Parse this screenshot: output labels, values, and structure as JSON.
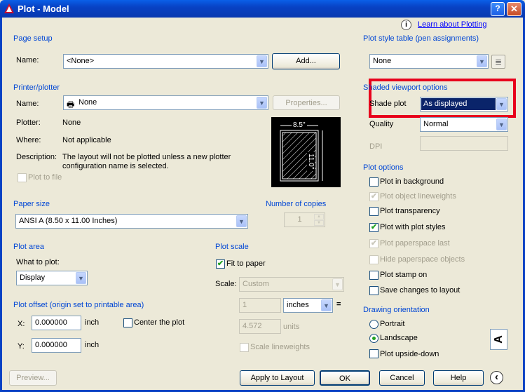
{
  "window": {
    "title": "Plot - Model",
    "help_btn": "?",
    "close_btn": "✕"
  },
  "help_link": {
    "info_icon": "i",
    "label": "Learn about Plotting"
  },
  "page_setup": {
    "group": "Page setup",
    "name_label": "Name:",
    "name_value": "<None>",
    "add_button": "Add..."
  },
  "printer": {
    "group": "Printer/plotter",
    "name_label": "Name:",
    "name_value": "None",
    "properties_button": "Properties...",
    "plotter_label": "Plotter:",
    "plotter_value": "None",
    "where_label": "Where:",
    "where_value": "Not applicable",
    "description_label": "Description:",
    "description_line1": "The layout will not be plotted unless a new plotter",
    "description_line2": "configuration name is selected.",
    "plot_to_file": "Plot to file",
    "preview_width": "8.5''",
    "preview_height": "11.0''"
  },
  "paper_size": {
    "group": "Paper size",
    "value": "ANSI A (8.50 x 11.00 Inches)"
  },
  "copies": {
    "group": "Number of copies",
    "value": "1"
  },
  "plot_area": {
    "group": "Plot area",
    "what_label": "What to plot:",
    "what_value": "Display"
  },
  "plot_offset": {
    "group": "Plot offset (origin set to printable area)",
    "x_label": "X:",
    "x_value": "0.000000",
    "x_unit": "inch",
    "y_label": "Y:",
    "y_value": "0.000000",
    "y_unit": "inch",
    "center": "Center the plot"
  },
  "plot_scale": {
    "group": "Plot scale",
    "fit": "Fit to paper",
    "scale_label": "Scale:",
    "scale_value": "Custom",
    "num_value": "1",
    "unit_value": "inches",
    "equals": "=",
    "den_value": "4.572",
    "den_unit": "units",
    "scale_lineweights": "Scale lineweights"
  },
  "style_table": {
    "group": "Plot style table (pen assignments)",
    "value": "None"
  },
  "shaded": {
    "group": "Shaded viewport options",
    "shade_label": "Shade plot",
    "shade_value": "As displayed",
    "quality_label": "Quality",
    "quality_value": "Normal",
    "dpi_label": "DPI",
    "highlight_color": "#e8001c"
  },
  "plot_options": {
    "group": "Plot options",
    "items": [
      {
        "label": "Plot in background",
        "checked": false,
        "enabled": true
      },
      {
        "label": "Plot object lineweights",
        "checked": true,
        "enabled": false
      },
      {
        "label": "Plot transparency",
        "checked": false,
        "enabled": true
      },
      {
        "label": "Plot with plot styles",
        "checked": true,
        "enabled": true
      },
      {
        "label": "Plot paperspace last",
        "checked": true,
        "enabled": false
      },
      {
        "label": "Hide paperspace objects",
        "checked": false,
        "enabled": false
      },
      {
        "label": "Plot stamp on",
        "checked": false,
        "enabled": true
      },
      {
        "label": "Save changes to layout",
        "checked": false,
        "enabled": true
      }
    ]
  },
  "orientation": {
    "group": "Drawing orientation",
    "portrait": "Portrait",
    "landscape": "Landscape",
    "upside_down": "Plot upside-down",
    "selected": "Landscape",
    "preview_letter": "A"
  },
  "footer": {
    "preview": "Preview...",
    "apply": "Apply to Layout",
    "ok": "OK",
    "cancel": "Cancel",
    "help": "Help",
    "collapse_icon": "‹"
  }
}
